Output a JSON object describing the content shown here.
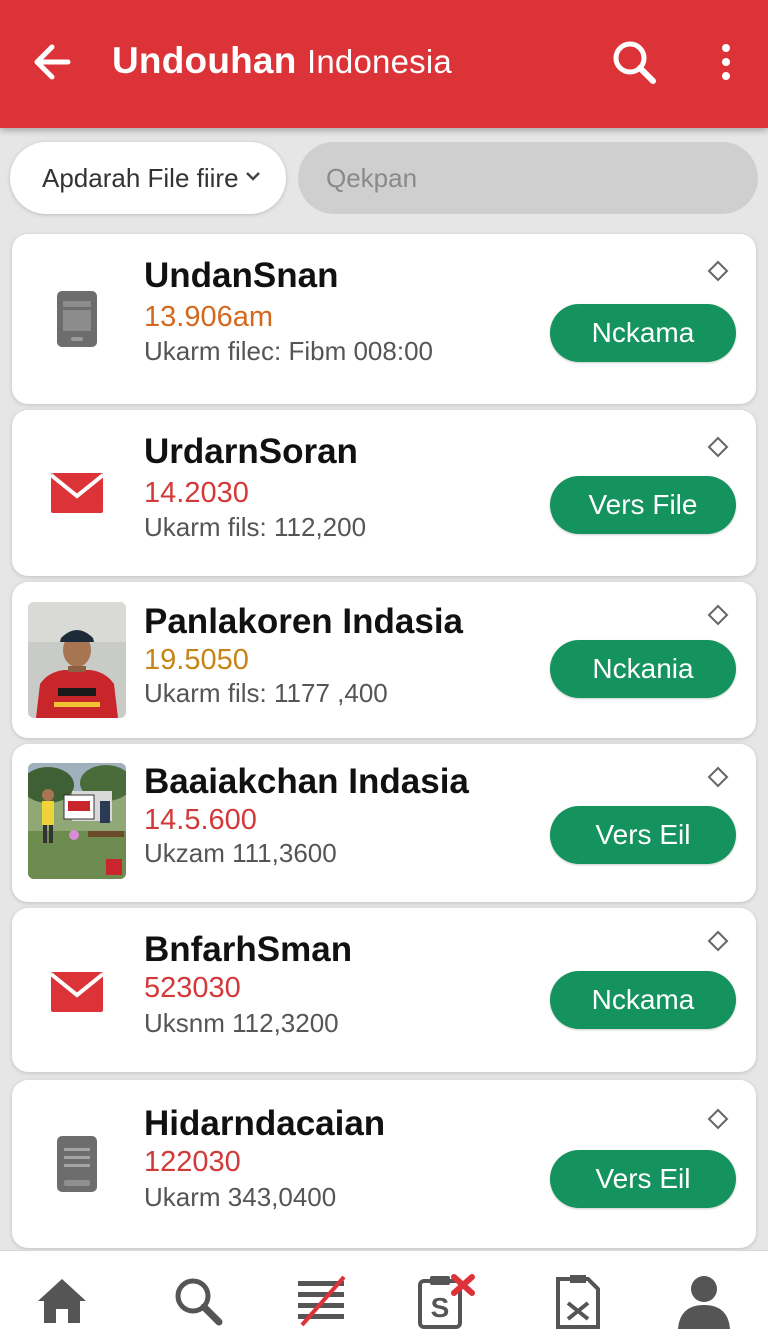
{
  "appbar": {
    "title_bold": "Undouhan",
    "title_light": "Indonesia"
  },
  "filter": {
    "dropdown_label": "Apdarah File fiire",
    "search_placeholder": "Qekpan"
  },
  "files": [
    {
      "name": "UndanSnan",
      "size": "13.906am",
      "size_color": "#d2691e",
      "meta": "Ukarm filec: Fibm 008:00",
      "action": "Nckama",
      "icon": "tablet-icon"
    },
    {
      "name": "UrdarnSoran",
      "size": "14.2030",
      "size_color": "#d23a3a",
      "meta": "Ukarm fils: 112,200",
      "action": "Vers File",
      "icon": "mail-icon"
    },
    {
      "name": "Panlakoren Indasia",
      "size": "19.5050",
      "size_color": "#c78418",
      "meta": "Ukarm fils: 1177 ,400",
      "action": "Nckania",
      "icon": "portrait-photo"
    },
    {
      "name": "Baaiakchan Indasia",
      "size": "14.5.600",
      "size_color": "#d23a3a",
      "meta": "Ukzam 111,3600",
      "action": "Vers Eil",
      "icon": "outdoor-photo"
    },
    {
      "name": "BnfarhSman",
      "size": "523030",
      "size_color": "#d23a3a",
      "meta": "Uksnm 112,3200",
      "action": "Nckama",
      "icon": "mail-icon"
    },
    {
      "name": "Hidarndacaian",
      "size": "122030",
      "size_color": "#d23a3a",
      "meta": "Ukarm 343,0400",
      "action": "Vers Eil",
      "icon": "document-icon"
    }
  ],
  "colors": {
    "appbar": "#dc3338",
    "action_button": "#14935e"
  }
}
